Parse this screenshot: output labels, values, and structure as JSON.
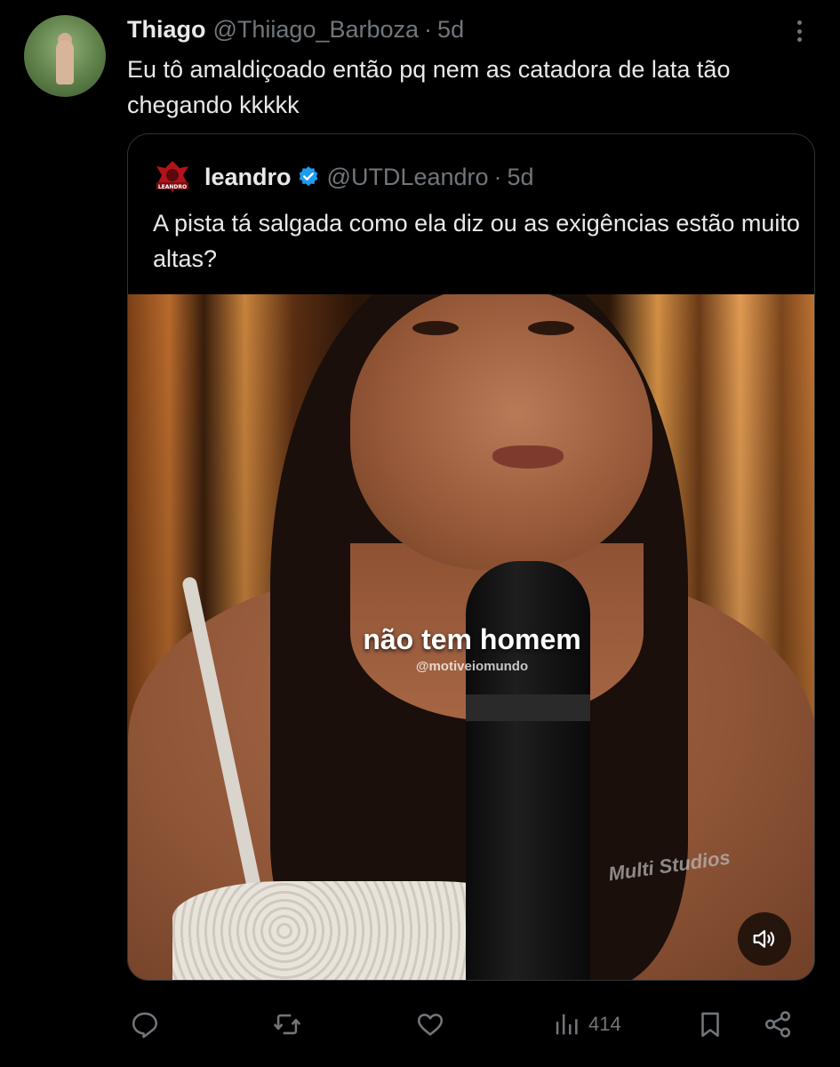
{
  "post": {
    "author_name": "Thiago",
    "author_handle": "@Thiiago_Barboza",
    "separator": "·",
    "time": "5d",
    "text": "Eu tô amaldiçoado então pq nem as catadora de lata tão chegando kkkkk",
    "more_icon": "more-vertical-icon"
  },
  "quote": {
    "author_name": "leandro",
    "author_handle": "@UTDLeandro",
    "separator": "·",
    "time": "5d",
    "text": "A pista tá salgada como ela diz ou as exigências estão muito altas?",
    "logo_text": "LEANDRO",
    "verified_color": "#1d9bf0",
    "media": {
      "caption": "não tem homem",
      "watermark": "@motiveiomundo",
      "mic_brand": "Multi Studios",
      "sound_icon": "speaker-icon"
    }
  },
  "actions": {
    "reply_icon": "reply-icon",
    "retweet_icon": "retweet-icon",
    "like_icon": "heart-icon",
    "views_icon": "views-icon",
    "views_count": "414",
    "bookmark_icon": "bookmark-icon",
    "share_icon": "share-icon"
  }
}
